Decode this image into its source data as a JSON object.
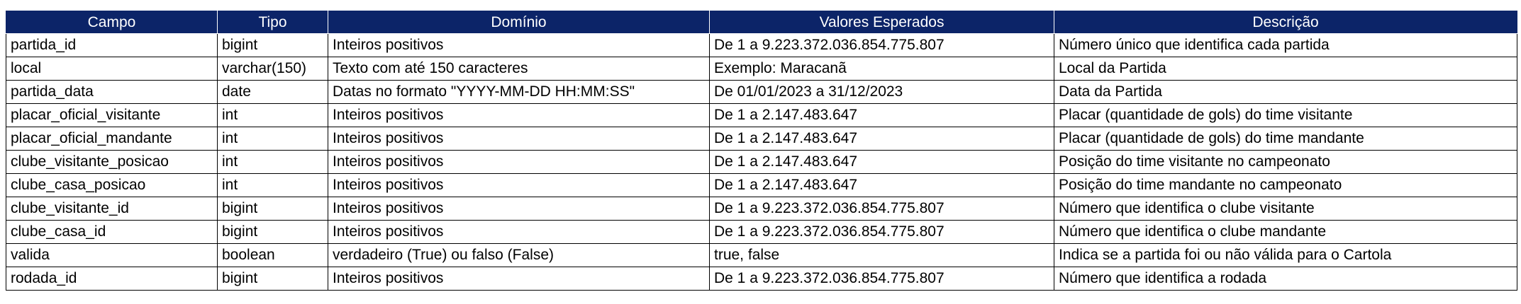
{
  "table": {
    "headers": [
      "Campo",
      "Tipo",
      "Domínio",
      "Valores Esperados",
      "Descrição"
    ],
    "rows": [
      [
        "partida_id",
        "bigint",
        "Inteiros positivos",
        "De 1 a 9.223.372.036.854.775.807",
        "Número único que identifica cada partida"
      ],
      [
        "local",
        "varchar(150)",
        "Texto com até 150 caracteres",
        "Exemplo:  Maracanã",
        "Local da Partida"
      ],
      [
        "partida_data",
        "date",
        "Datas no formato \"YYYY-MM-DD HH:MM:SS\"",
        "De 01/01/2023 a 31/12/2023",
        "Data da Partida"
      ],
      [
        "placar_oficial_visitante",
        "int",
        "Inteiros positivos",
        "De 1 a 2.147.483.647",
        "Placar (quantidade de gols) do time visitante"
      ],
      [
        "placar_oficial_mandante",
        "int",
        "Inteiros positivos",
        "De 1 a 2.147.483.647",
        "Placar (quantidade de gols) do time mandante"
      ],
      [
        "clube_visitante_posicao",
        "int",
        "Inteiros positivos",
        "De 1 a 2.147.483.647",
        "Posição do time visitante no campeonato"
      ],
      [
        "clube_casa_posicao",
        "int",
        "Inteiros positivos",
        "De 1 a 2.147.483.647",
        "Posição do time mandante no campeonato"
      ],
      [
        "clube_visitante_id",
        "bigint",
        "Inteiros positivos",
        "De 1 a 9.223.372.036.854.775.807",
        "Número que identifica o clube visitante"
      ],
      [
        "clube_casa_id",
        "bigint",
        "Inteiros positivos",
        "De 1 a 9.223.372.036.854.775.807",
        "Número que identifica o clube mandante"
      ],
      [
        "valida",
        "boolean",
        "verdadeiro (True) ou falso (False)",
        "true, false",
        "Indica se a partida foi ou não válida para o Cartola"
      ],
      [
        "rodada_id",
        "bigint",
        "Inteiros positivos",
        "De 1 a 9.223.372.036.854.775.807",
        "Número que identifica a rodada"
      ]
    ]
  },
  "colors": {
    "header_background": "#0c2468",
    "header_text": "#ffffff",
    "grid_line": "#000000"
  }
}
